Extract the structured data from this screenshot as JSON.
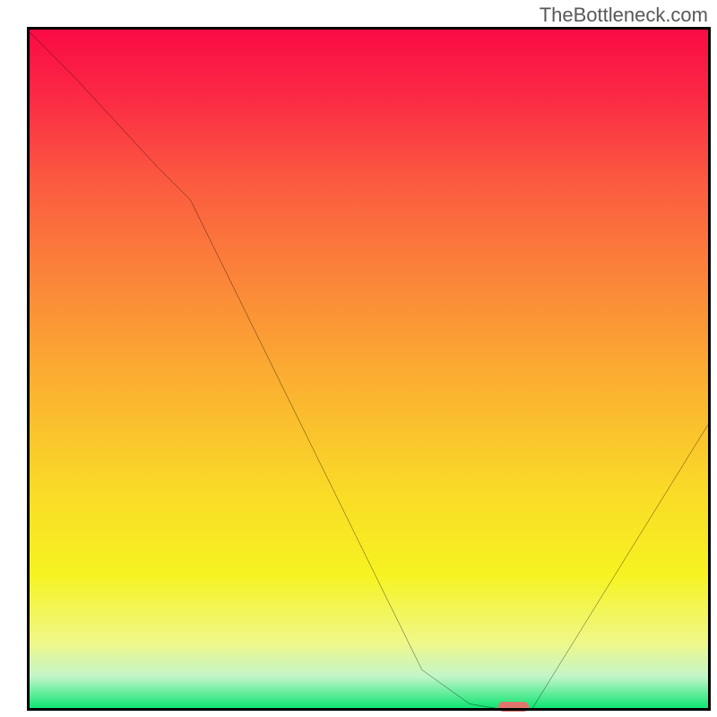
{
  "watermark": "TheBottleneck.com",
  "chart_data": {
    "type": "line",
    "title": "",
    "xlabel": "",
    "ylabel": "",
    "xlim": [
      0,
      100
    ],
    "ylim": [
      0,
      100
    ],
    "grid": false,
    "background_gradient": [
      {
        "stop": 0,
        "color": "#fa0b44"
      },
      {
        "stop": 22,
        "color": "#fb5940"
      },
      {
        "stop": 50,
        "color": "#fbab32"
      },
      {
        "stop": 80,
        "color": "#f6f321"
      },
      {
        "stop": 95,
        "color": "#c2f5c9"
      },
      {
        "stop": 100,
        "color": "#00e46b"
      }
    ],
    "series": [
      {
        "name": "bottleneck-curve",
        "color": "#000000",
        "x": [
          0,
          7,
          19,
          24,
          58,
          65,
          71,
          74,
          100
        ],
        "y": [
          100,
          93,
          80,
          75,
          6,
          1,
          0,
          0,
          42
        ]
      }
    ],
    "annotations": [
      {
        "name": "optimal-marker",
        "shape": "rounded-bar",
        "color": "#e0756d",
        "x": 71.5,
        "y": 0.6,
        "width_pct": 4.5,
        "height_pct": 1.4
      }
    ]
  }
}
